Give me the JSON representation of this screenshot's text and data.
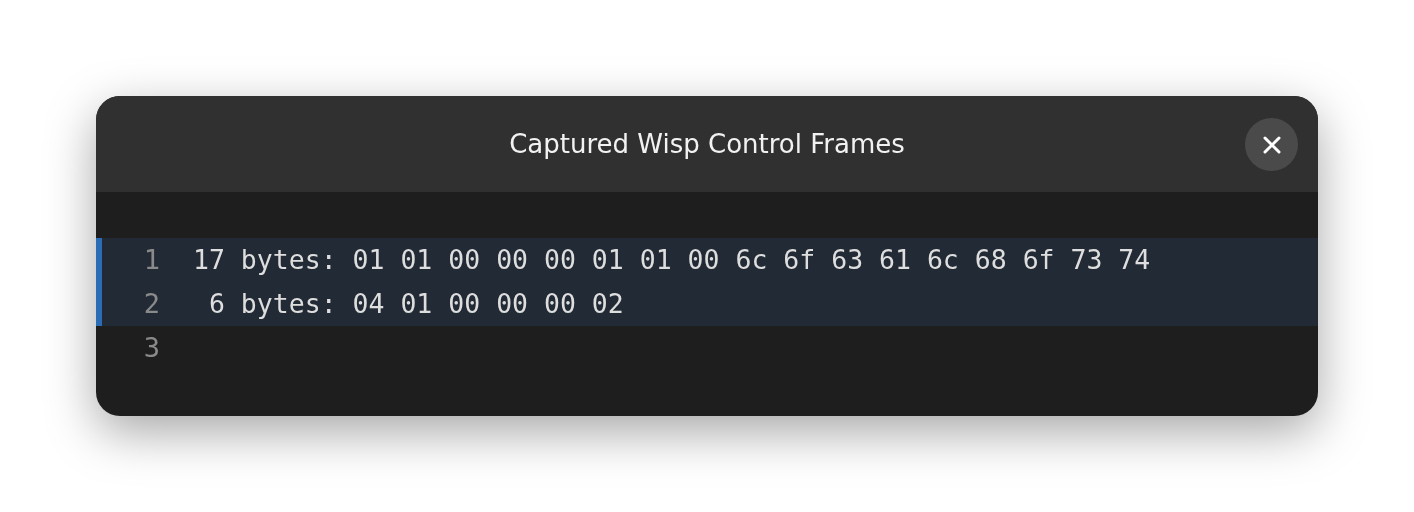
{
  "window": {
    "title": "Captured Wisp Control Frames"
  },
  "lines": [
    {
      "number": "1",
      "text": "17 bytes: 01 01 00 00 00 01 01 00 6c 6f 63 61 6c 68 6f 73 74",
      "selected": true
    },
    {
      "number": "2",
      "text": " 6 bytes: 04 01 00 00 00 02",
      "selected": true
    },
    {
      "number": "3",
      "selected": false
    }
  ]
}
